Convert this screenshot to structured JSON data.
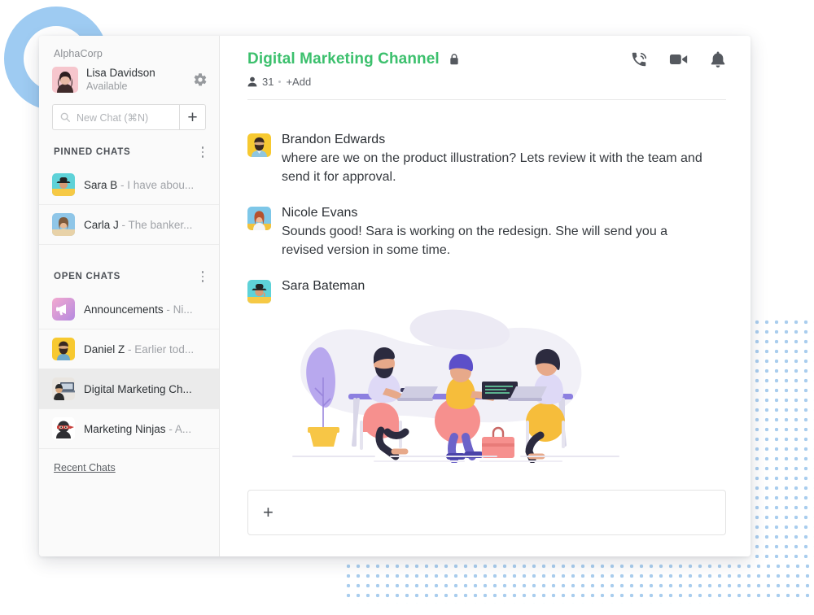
{
  "decor": {
    "ring_color": "#9ecbf2",
    "dot_color": "#a9cdee"
  },
  "sidebar": {
    "org_name": "AlphaCorp",
    "profile": {
      "name": "Lisa Davidson",
      "status": "Available",
      "settings_icon": "gear-icon"
    },
    "search": {
      "placeholder": "New Chat (⌘N)",
      "icon": "search-icon",
      "add_label": "+"
    },
    "sections": [
      {
        "title": "PINNED CHATS",
        "menu_icon": "more-vertical-icon",
        "items": [
          {
            "name": "Sara B",
            "preview": "- I have abou...",
            "avatar": "sara-b-avatar",
            "selected": false
          },
          {
            "name": "Carla J",
            "preview": "- The banker...",
            "avatar": "carla-j-avatar",
            "selected": false
          }
        ]
      },
      {
        "title": "OPEN CHATS",
        "menu_icon": "more-vertical-icon",
        "items": [
          {
            "name": "Announcements",
            "preview": "- Ni...",
            "avatar": "announcements-avatar",
            "selected": false
          },
          {
            "name": "Daniel Z",
            "preview": "- Earlier tod...",
            "avatar": "daniel-z-avatar",
            "selected": false
          },
          {
            "name": "Digital Marketing Ch...",
            "preview": "",
            "avatar": "digital-marketing-avatar",
            "selected": true
          },
          {
            "name": "Marketing Ninjas",
            "preview": "- A...",
            "avatar": "marketing-ninjas-avatar",
            "selected": false
          }
        ]
      }
    ],
    "recent_chats_label": "Recent Chats"
  },
  "header": {
    "channel_title": "Digital Marketing Channel",
    "title_color": "#3cc06d",
    "lock_icon": "lock-icon",
    "member_count": "31",
    "add_label": "+Add",
    "actions": [
      {
        "icon": "phone-call-icon",
        "label": "Call"
      },
      {
        "icon": "video-camera-icon",
        "label": "Video"
      },
      {
        "icon": "bell-icon",
        "label": "Notifications"
      }
    ]
  },
  "messages": [
    {
      "author": "Brandon Edwards",
      "avatar": "brandon-edwards-avatar",
      "text": "where are we on the product illustration? Lets review it with the team and send it for approval."
    },
    {
      "author": "Nicole Evans",
      "avatar": "nicole-evans-avatar",
      "text": "Sounds good! Sara is working on the redesign. She will send you a revised version in some time."
    },
    {
      "author": "Sara Bateman",
      "avatar": "sara-bateman-avatar",
      "text": "",
      "attachment": "team-working-at-desk-illustration"
    }
  ],
  "composer": {
    "add_label": "+",
    "placeholder": ""
  }
}
